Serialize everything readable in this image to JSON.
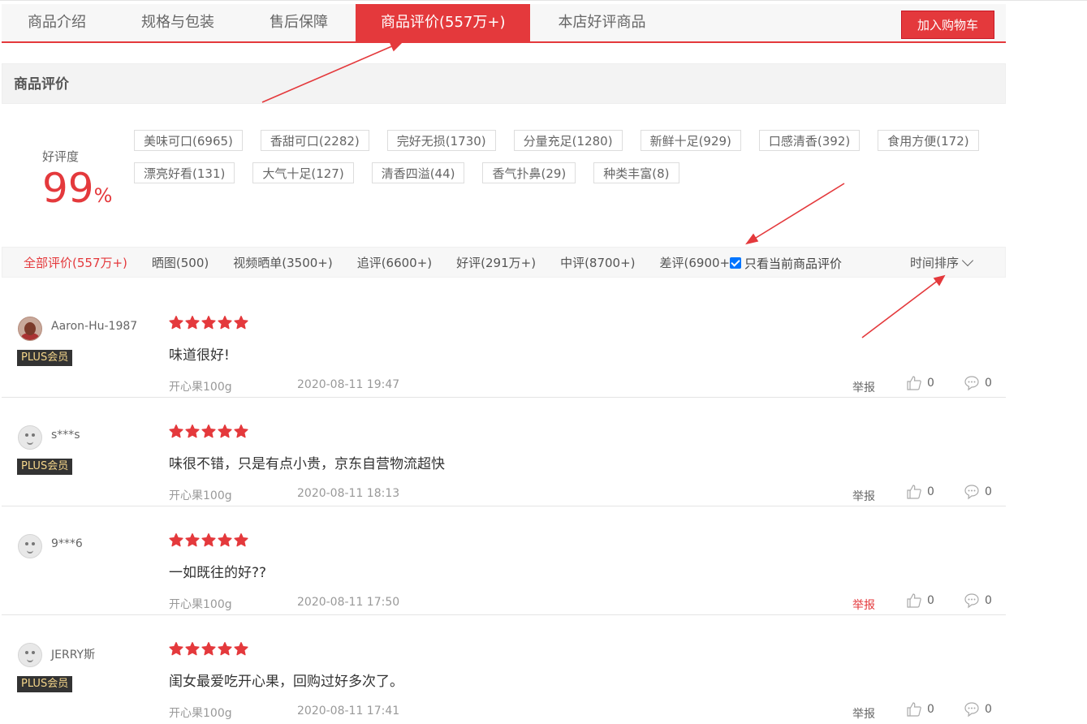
{
  "tabs": [
    {
      "label": "商品介绍"
    },
    {
      "label": "规格与包装"
    },
    {
      "label": "售后保障"
    },
    {
      "label": "商品评价(557万+)"
    },
    {
      "label": "本店好评商品"
    }
  ],
  "cart_button": "加入购物车",
  "section_title": "商品评价",
  "rate": {
    "label": "好评度",
    "value": "99",
    "unit": "%"
  },
  "tags": [
    "美味可口(6965)",
    "香甜可口(2282)",
    "完好无损(1730)",
    "分量充足(1280)",
    "新鲜十足(929)",
    "口感清香(392)",
    "食用方便(172)",
    "漂亮好看(131)",
    "大气十足(127)",
    "清香四溢(44)",
    "香气扑鼻(29)",
    "种类丰富(8)"
  ],
  "filters": [
    "全部评价(557万+)",
    "晒图(500)",
    "视频晒单(3500+)",
    "追评(6600+)",
    "好评(291万+)",
    "中评(8700+)",
    "差评(6900+)"
  ],
  "only_current_label": "只看当前商品评价",
  "sort_label": "时间排序",
  "colors": {
    "accent": "#e4393c",
    "plus_bg": "#333333",
    "plus_text": "#f5d68a"
  },
  "reviews": [
    {
      "user": "Aaron-Hu-1987",
      "plus": "PLUS会员",
      "stars": 5,
      "content": "味道很好!",
      "product": "开心果100g",
      "time": "2020-08-11 19:47",
      "report": "举报",
      "likes": "0",
      "comments": "0"
    },
    {
      "user": "s***s",
      "plus": "PLUS会员",
      "stars": 5,
      "content": "味很不错，只是有点小贵，京东自营物流超快",
      "product": "开心果100g",
      "time": "2020-08-11 18:13",
      "report": "举报",
      "likes": "0",
      "comments": "0"
    },
    {
      "user": "9***6",
      "plus": "",
      "stars": 5,
      "content": "一如既往的好??",
      "product": "开心果100g",
      "time": "2020-08-11 17:50",
      "report": "举报",
      "likes": "0",
      "comments": "0"
    },
    {
      "user": "JERRY斯",
      "plus": "PLUS会员",
      "stars": 5,
      "content": "闺女最爱吃开心果，回购过好多次了。",
      "product": "开心果100g",
      "time": "2020-08-11 17:41",
      "report": "举报",
      "likes": "0",
      "comments": "0"
    }
  ]
}
